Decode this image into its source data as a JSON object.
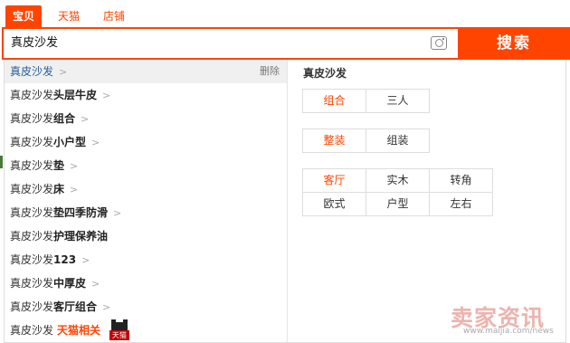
{
  "tabs": [
    {
      "label": "宝贝",
      "active": true
    },
    {
      "label": "天猫",
      "active": false
    },
    {
      "label": "店铺",
      "active": false
    }
  ],
  "search": {
    "value": "真皮沙发",
    "button_label": "搜索"
  },
  "suggestions": [
    {
      "base": "真皮沙发",
      "suffix": "",
      "arrow": true,
      "active": true,
      "delete_label": "删除"
    },
    {
      "base": "真皮沙发",
      "suffix": "头层牛皮",
      "arrow": true
    },
    {
      "base": "真皮沙发",
      "suffix": "组合",
      "arrow": true
    },
    {
      "base": "真皮沙发",
      "suffix": "小户型",
      "arrow": true
    },
    {
      "base": "真皮沙发",
      "suffix": "垫",
      "arrow": true
    },
    {
      "base": "真皮沙发",
      "suffix": "床",
      "arrow": true
    },
    {
      "base": "真皮沙发",
      "suffix": "垫四季防滑",
      "arrow": true
    },
    {
      "base": "真皮沙发",
      "suffix": "护理保养油",
      "arrow": false
    },
    {
      "base": "真皮沙发",
      "suffix": "123",
      "arrow": true
    },
    {
      "base": "真皮沙发",
      "suffix": "中厚皮",
      "arrow": true
    },
    {
      "base": "真皮沙发",
      "suffix": "客厅组合",
      "arrow": true
    },
    {
      "base": "真皮沙发",
      "suffix": "",
      "arrow": false,
      "tmall_label": "天猫相关",
      "tmall_icon_text": "天猫"
    }
  ],
  "panel": {
    "title": "真皮沙发",
    "groups": [
      {
        "options": [
          {
            "label": "组合",
            "selected": true
          },
          {
            "label": "三人",
            "selected": false
          }
        ]
      },
      {
        "options": [
          {
            "label": "整装",
            "selected": true
          },
          {
            "label": "组装",
            "selected": false
          }
        ]
      },
      {
        "options": [
          {
            "label": "客厅",
            "selected": true
          },
          {
            "label": "实木",
            "selected": false
          },
          {
            "label": "转角",
            "selected": false
          },
          {
            "label": "欧式",
            "selected": false
          },
          {
            "label": "户型",
            "selected": false
          },
          {
            "label": "左右",
            "selected": false
          }
        ]
      }
    ]
  },
  "watermark": {
    "text": "卖家资讯",
    "url": "www.maijia.com/news"
  },
  "colors": {
    "accent": "#ff4400",
    "active_link": "#2b5d9b"
  }
}
